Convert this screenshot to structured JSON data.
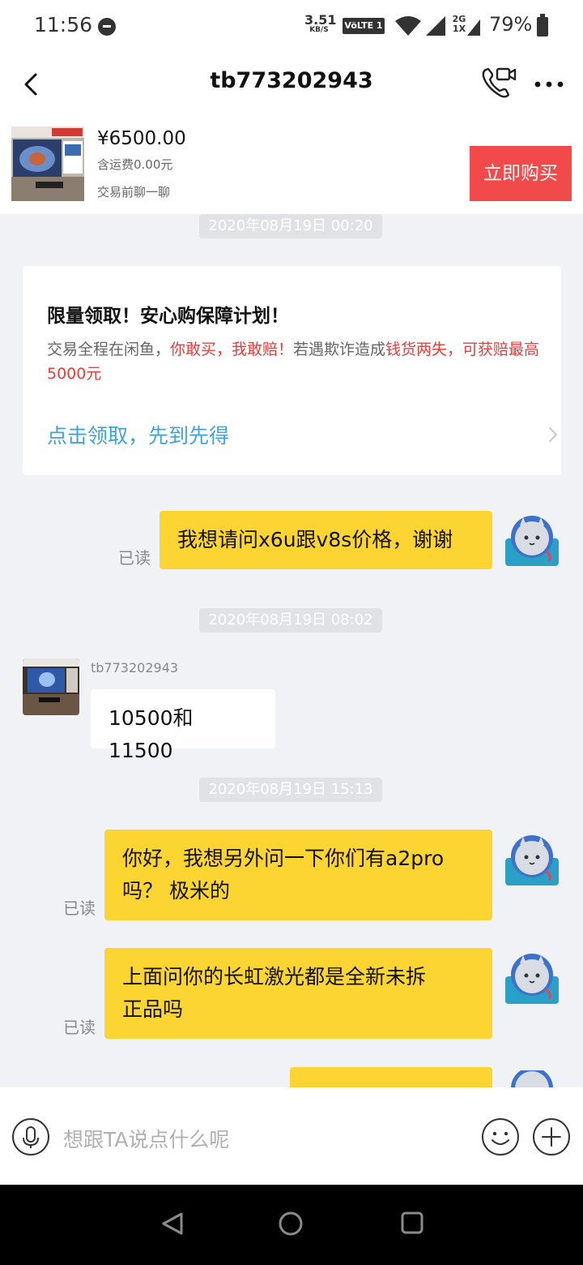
{
  "status_bar": {
    "time": "11:56",
    "net_speed_value": "3.51",
    "net_speed_unit": "KB/S",
    "volte": "VöLTE 1",
    "network_2g": "2G",
    "network_1x": "1X",
    "battery": "79%"
  },
  "header": {
    "title": "tb773202943"
  },
  "product": {
    "price": "¥6500.00",
    "shipping": "含运费0.00元",
    "tip": "交易前聊一聊",
    "buy_label": "立即购买"
  },
  "timestamps": [
    "2020年08月19日 00:20",
    "2020年08月19日 08:02",
    "2020年08月19日 15:13"
  ],
  "card": {
    "title": "限量领取！安心购保障计划！",
    "body_1": "交易全程在闲鱼，",
    "body_2": "你敢买，我敢赔！",
    "body_3": "若遇欺诈造成",
    "body_4": "钱货两失，可获赔最高5000元",
    "link": "点击领取，先到先得"
  },
  "messages": {
    "read_label": "已读",
    "peer_name": "tb773202943",
    "m1": "我想请问x6u跟v8s价格，谢谢",
    "m2": "10500和11500",
    "m3_line1": "你好，我想另外问一下你们有a2pro",
    "m3_line2": "吗？ 极米的",
    "m4_line1": "上面问你的长虹激光都是全新未拆",
    "m4_line2": "正品吗"
  },
  "input": {
    "placeholder": "想跟TA说点什么呢"
  },
  "colors": {
    "bubble_self": "#fdd532",
    "buy_button": "#f24a4a",
    "link": "#3ea3d8",
    "warning_red": "#ec3b3b",
    "background": "#f1f2f6"
  },
  "icons": [
    "back-icon",
    "video-call-icon",
    "more-icon",
    "mic-icon",
    "emoji-icon",
    "plus-icon",
    "nav-back-icon",
    "nav-home-icon",
    "nav-recent-icon"
  ]
}
